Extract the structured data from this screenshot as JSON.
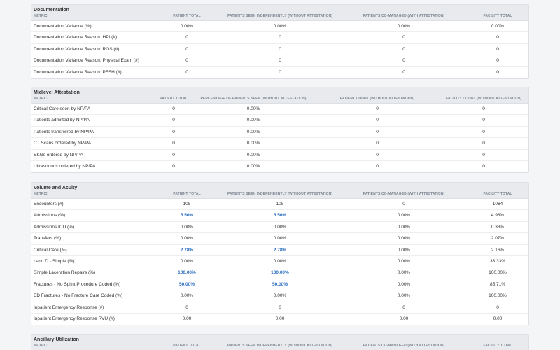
{
  "sections": [
    {
      "title": "Documentation",
      "cols": [
        {
          "label": "METRIC"
        },
        {
          "label": "PATIENT TOTAL"
        },
        {
          "label": "PATIENTS SEEN INDEPENDENTLY (WITHOUT ATTESTATION)"
        },
        {
          "label": "PATIENTS CO-MANAGED (WITH ATTESTATION)"
        },
        {
          "label": "FACILITY TOTAL"
        }
      ],
      "rows": [
        {
          "cells": [
            {
              "v": "Documentation Variance (%)"
            },
            {
              "v": "0.00%"
            },
            {
              "v": "0.00%"
            },
            {
              "v": "0.00%"
            },
            {
              "v": "0.00%"
            }
          ]
        },
        {
          "cells": [
            {
              "v": "Documentation Variance Reason: HPI (#)"
            },
            {
              "v": "0"
            },
            {
              "v": "0"
            },
            {
              "v": "0"
            },
            {
              "v": "0"
            }
          ]
        },
        {
          "cells": [
            {
              "v": "Documentation Variance Reason: ROS (#)"
            },
            {
              "v": "0"
            },
            {
              "v": "0"
            },
            {
              "v": "0"
            },
            {
              "v": "0"
            }
          ]
        },
        {
          "cells": [
            {
              "v": "Documentation Variance Reason: Physical Exam (#)"
            },
            {
              "v": "0"
            },
            {
              "v": "0"
            },
            {
              "v": "0"
            },
            {
              "v": "0"
            }
          ]
        },
        {
          "cells": [
            {
              "v": "Documentation Variance Reason: PFSH (#)"
            },
            {
              "v": "0"
            },
            {
              "v": "0"
            },
            {
              "v": "0"
            },
            {
              "v": "0"
            }
          ]
        }
      ]
    },
    {
      "title": "Midlevel Attestation",
      "cols": [
        {
          "label": "METRIC"
        },
        {
          "label": "PATIENT TOTAL"
        },
        {
          "label": "PERCENTAGE OF PATIENTS SEEN (WITHOUT ATTESTATION)"
        },
        {
          "label": "PATIENT COUNT (WITHOUT ATTESTATION)"
        },
        {
          "label": "FACILITY COUNT (WITHOUT ATTESTATION)"
        }
      ],
      "rows": [
        {
          "cells": [
            {
              "v": "Critical Care seen by NP/PA"
            },
            {
              "v": "0"
            },
            {
              "v": "0.00%"
            },
            {
              "v": "0"
            },
            {
              "v": "0"
            }
          ]
        },
        {
          "cells": [
            {
              "v": "Patients admitted by NP/PA"
            },
            {
              "v": "0"
            },
            {
              "v": "0.00%"
            },
            {
              "v": "0"
            },
            {
              "v": "0"
            }
          ]
        },
        {
          "cells": [
            {
              "v": "Patients transferred by NP/PA"
            },
            {
              "v": "0"
            },
            {
              "v": "0.00%"
            },
            {
              "v": "0"
            },
            {
              "v": "0"
            }
          ]
        },
        {
          "cells": [
            {
              "v": "CT Scans ordered by NP/PA"
            },
            {
              "v": "0"
            },
            {
              "v": "0.00%"
            },
            {
              "v": "0"
            },
            {
              "v": "0"
            }
          ]
        },
        {
          "cells": [
            {
              "v": "EKGs ordered by NP/PA"
            },
            {
              "v": "0"
            },
            {
              "v": "0.00%"
            },
            {
              "v": "0"
            },
            {
              "v": "0"
            }
          ]
        },
        {
          "cells": [
            {
              "v": "Ultrasounds ordered by NP/PA"
            },
            {
              "v": "0"
            },
            {
              "v": "0.00%"
            },
            {
              "v": "0"
            },
            {
              "v": "0"
            }
          ]
        }
      ]
    },
    {
      "title": "Volume and Acuity",
      "cols": [
        {
          "label": "METRIC"
        },
        {
          "label": "PATIENT TOTAL"
        },
        {
          "label": "PATIENTS SEEN INDEPENDENTLY (WITHOUT ATTESTATION)"
        },
        {
          "label": "PATIENTS CO-MANAGED (WITH ATTESTATION)"
        },
        {
          "label": "FACILITY TOTAL"
        }
      ],
      "rows": [
        {
          "cells": [
            {
              "v": "Encounters (#)"
            },
            {
              "v": "108"
            },
            {
              "v": "108"
            },
            {
              "v": "0"
            },
            {
              "v": "1064"
            }
          ]
        },
        {
          "cells": [
            {
              "v": "Admissions (%)"
            },
            {
              "v": "5.56%",
              "hl": true
            },
            {
              "v": "5.56%",
              "hl": true
            },
            {
              "v": "0.00%"
            },
            {
              "v": "4.98%"
            }
          ]
        },
        {
          "cells": [
            {
              "v": "Admissions ICU (%)"
            },
            {
              "v": "0.00%"
            },
            {
              "v": "0.00%"
            },
            {
              "v": "0.00%"
            },
            {
              "v": "0.38%"
            }
          ]
        },
        {
          "cells": [
            {
              "v": "Transfers (%)"
            },
            {
              "v": "0.00%"
            },
            {
              "v": "0.00%"
            },
            {
              "v": "0.00%"
            },
            {
              "v": "2.07%"
            }
          ]
        },
        {
          "cells": [
            {
              "v": "Critical Care (%)"
            },
            {
              "v": "2.78%",
              "hl": true
            },
            {
              "v": "2.78%",
              "hl": true
            },
            {
              "v": "0.00%"
            },
            {
              "v": "2.16%"
            }
          ]
        },
        {
          "cells": [
            {
              "v": "I and D - Simple (%)"
            },
            {
              "v": "0.00%"
            },
            {
              "v": "0.00%"
            },
            {
              "v": "0.00%"
            },
            {
              "v": "33.33%"
            }
          ]
        },
        {
          "cells": [
            {
              "v": "Simple Laceration Repairs (%)"
            },
            {
              "v": "100.00%",
              "hl": true
            },
            {
              "v": "100.00%",
              "hl": true
            },
            {
              "v": "0.00%"
            },
            {
              "v": "100.00%"
            }
          ]
        },
        {
          "cells": [
            {
              "v": "Fractures - No Splint Procedure Coded (%)"
            },
            {
              "v": "50.00%",
              "hl": true
            },
            {
              "v": "50.00%",
              "hl": true
            },
            {
              "v": "0.00%"
            },
            {
              "v": "85.71%"
            }
          ]
        },
        {
          "cells": [
            {
              "v": "ED Fractures - No Fracture Care Coded (%)"
            },
            {
              "v": "0.00%"
            },
            {
              "v": "0.00%"
            },
            {
              "v": "0.00%"
            },
            {
              "v": "100.00%"
            }
          ]
        },
        {
          "cells": [
            {
              "v": "Inpatient Emergency Response (#)"
            },
            {
              "v": "0"
            },
            {
              "v": "0"
            },
            {
              "v": "0"
            },
            {
              "v": "0"
            }
          ]
        },
        {
          "cells": [
            {
              "v": "Inpatient Emergency Response RVU (#)"
            },
            {
              "v": "0.00"
            },
            {
              "v": "0.00"
            },
            {
              "v": "0.00"
            },
            {
              "v": "0.00"
            }
          ]
        }
      ]
    },
    {
      "title": "Ancillary Utilization",
      "cols": [
        {
          "label": "METRIC"
        },
        {
          "label": "PATIENT TOTAL"
        },
        {
          "label": "PATIENTS SEEN INDEPENDENTLY (WITHOUT ATTESTATION)"
        },
        {
          "label": "PATIENTS CO-MANAGED (WITH ATTESTATION)"
        },
        {
          "label": "FACILITY TOTAL"
        }
      ],
      "rows": []
    }
  ]
}
